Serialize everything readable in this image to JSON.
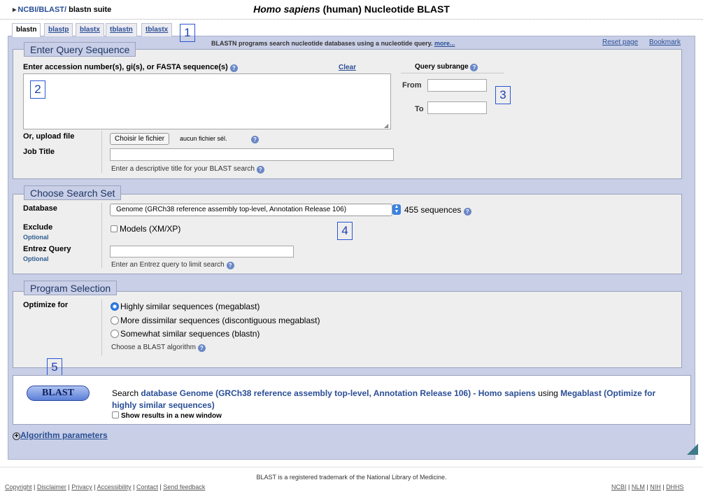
{
  "breadcrumb": {
    "ncbi": "NCBI/",
    "blast": "BLAST/",
    "suite": "blastn suite"
  },
  "title": {
    "species": "Homo sapiens",
    "rest": " (human) Nucleotide BLAST"
  },
  "tabs": [
    "blastn",
    "blastp",
    "blastx",
    "tblastn",
    "tblastx"
  ],
  "description": {
    "text": "BLASTN programs search nucleotide databases using a nucleotide query.",
    "more": "more..."
  },
  "top_links": {
    "reset": "Reset page",
    "bookmark": "Bookmark"
  },
  "query": {
    "legend": "Enter Query Sequence",
    "label": "Enter accession number(s), gi(s), or FASTA sequence(s)",
    "clear": "Clear",
    "sequence_value": "",
    "subrange_label": "Query subrange",
    "from_label": "From",
    "to_label": "To",
    "from_value": "",
    "to_value": "",
    "upload_label": "Or, upload file",
    "file_button": "Choisir le fichier",
    "file_status": "aucun fichier sél.",
    "job_title_label": "Job Title",
    "job_title_value": "",
    "job_title_hint": "Enter a descriptive title for your BLAST search"
  },
  "search_set": {
    "legend": "Choose Search Set",
    "database_label": "Database",
    "database_selected": "Genome (GRCh38 reference assembly top-level, Annotation Release 106)",
    "sequence_count": "455 sequences",
    "exclude_label": "Exclude",
    "optional": "Optional",
    "models_label": "Models (XM/XP)",
    "entrez_label": "Entrez Query",
    "entrez_value": "",
    "entrez_hint": "Enter an Entrez query to limit search"
  },
  "program": {
    "legend": "Program Selection",
    "optimize_label": "Optimize for",
    "options": [
      "Highly similar sequences (megablast)",
      "More dissimilar sequences (discontiguous megablast)",
      "Somewhat similar sequences (blastn)"
    ],
    "selected_index": 0,
    "hint": "Choose a BLAST algorithm"
  },
  "run": {
    "button": "BLAST",
    "search": "Search",
    "db_text": "database Genome (GRCh38 reference assembly top-level, Annotation Release 106) - Homo sapiens",
    "using": "using",
    "algo_text": "Megablast (Optimize for highly similar sequences)",
    "new_window": "Show results in a new window"
  },
  "algorithm_params": "Algorithm parameters",
  "annotations": [
    "1",
    "2",
    "3",
    "4",
    "5"
  ],
  "footer": {
    "trademark": "BLAST is a registered trademark of the National Library of Medicine.",
    "left_links": [
      "Copyright",
      "Disclaimer",
      "Privacy",
      "Accessibility",
      "Contact",
      "Send feedback"
    ],
    "right_links": [
      "NCBI",
      "NLM",
      "NIH",
      "DHHS"
    ]
  },
  "colors": {
    "panel": "#c8cfe6",
    "fieldset": "#eeeeee",
    "link": "#2a4e96",
    "annotation": "#2b56d6"
  }
}
